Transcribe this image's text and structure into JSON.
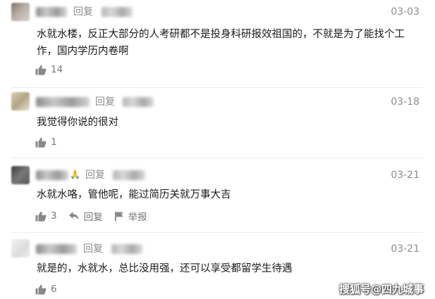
{
  "comments": [
    {
      "reply_label": "回复",
      "date": "03-03",
      "lines": [
        "水就水楼，反正大部分的人考研都不是投身科研报效祖国的，不就是为了能找个工",
        "作，国内学历内卷啊"
      ],
      "likes": "14"
    },
    {
      "reply_label": "回复",
      "date": "03-18",
      "lines": [
        "我觉得你说的很对"
      ],
      "likes": "1"
    },
    {
      "reply_label": "回复",
      "date": "03-21",
      "lines": [
        "水就水咯，管他呢，能过简历关就万事大吉"
      ],
      "likes": "3",
      "reply_action": "回复",
      "report_action": "举报"
    },
    {
      "reply_label": "回复",
      "date": "03-21",
      "lines": [
        "就是的，水就水，总比没用强，还可以享受都留学生待遇"
      ],
      "likes": "6"
    }
  ],
  "watermark": "搜狐号@四九城事",
  "colors": {
    "meta_text": "#8c8c8c",
    "body_text": "#1a1a1a",
    "action": "#777777"
  },
  "icons": [
    "thumbs-up-icon",
    "reply-arrow-icon",
    "report-flag-icon"
  ]
}
